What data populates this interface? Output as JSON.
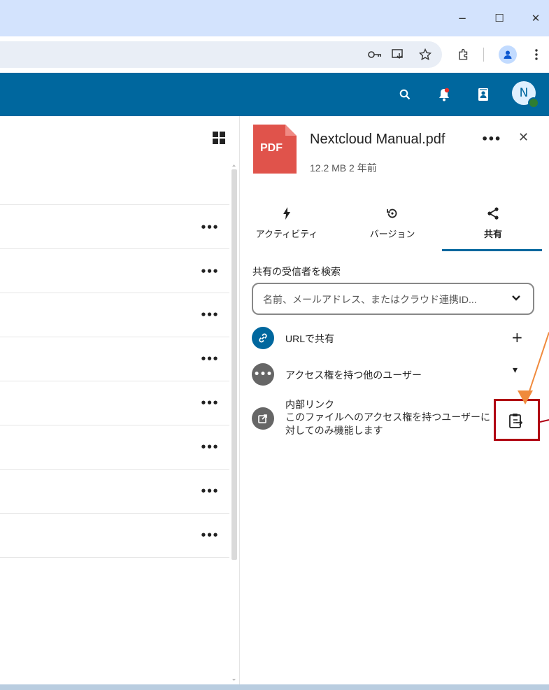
{
  "window": {
    "minimize": "−",
    "maximize": "☐",
    "close": "✕"
  },
  "toolbar": {
    "icons": [
      "key-icon",
      "install-app-icon",
      "star-icon",
      "extensions-icon",
      "profile-icon",
      "menu-icon"
    ]
  },
  "header": {
    "avatar_letter": "N"
  },
  "files": {
    "row_more_label": "•••",
    "rows": 8
  },
  "sidebar": {
    "file_name": "Nextcloud Manual.pdf",
    "file_meta": "12.2 MB 2 年前",
    "file_type_badge": "PDF",
    "more_label": "•••",
    "close_label": "✕",
    "tabs": [
      {
        "label": "アクティビティ",
        "icon": "lightning-icon"
      },
      {
        "label": "バージョン",
        "icon": "history-icon"
      },
      {
        "label": "共有",
        "icon": "share-icon",
        "active": true
      }
    ],
    "search_title": "共有の受信者を検索",
    "search_placeholder": "名前、メールアドレス、またはクラウド連携ID...",
    "share_link_label": "URLで共有",
    "share_link_action": "+",
    "others_label": "アクセス権を持つ他のユーザー",
    "others_action": "▾",
    "others_icon_label": "•••",
    "internal_title": "内部リンク",
    "internal_desc": "このファイルへのアクセス権を持つユーザーに対してのみ機能します"
  },
  "colors": {
    "brand": "#00679e",
    "pdf_red": "#e0534b",
    "highlight": "#b00012",
    "arrow": "#f08a3c"
  }
}
